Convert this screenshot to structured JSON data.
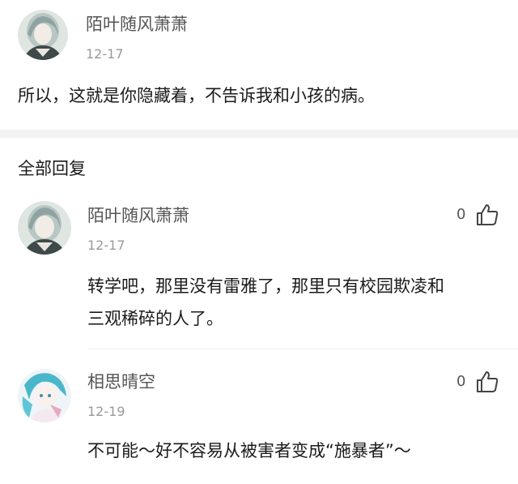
{
  "main_comment": {
    "username": "陌叶随风萧萧",
    "date": "12-17",
    "text": "所以，这就是你隐藏着，不告诉我和小孩的病。"
  },
  "replies_section": {
    "title": "全部回复",
    "replies": [
      {
        "username": "陌叶随风萧萧",
        "date": "12-17",
        "like_count": "0",
        "text_lines": [
          "转学吧，那里没有雷雅了，那里只有校园欺凌和",
          "三观稀碎的人了。"
        ]
      },
      {
        "username": "相思晴空",
        "date": "12-19",
        "like_count": "0",
        "text_lines": [
          "不可能～好不容易从被害者变成“施暴者”～"
        ]
      }
    ]
  },
  "icons": {
    "avatar": "avatar-icon",
    "like": "thumbs-up-icon"
  },
  "colors": {
    "username": "#555555",
    "date": "#9a9a9a",
    "text": "#1a1a1a",
    "divider": "#f2f2f2"
  }
}
